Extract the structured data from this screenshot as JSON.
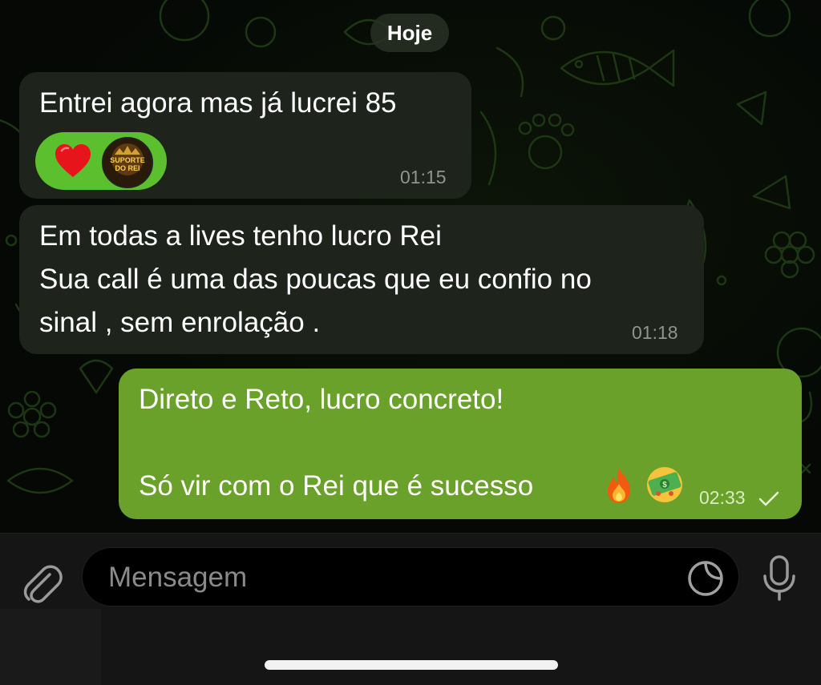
{
  "date_chip": "Hoje",
  "messages": [
    {
      "text": "Entrei agora mas já lucrei 85",
      "time": "01:15",
      "reactions": [
        "heart",
        "avatar"
      ]
    },
    {
      "text": "Em todas a lives tenho lucro Rei\nSua call é uma das poucas que eu confio no\nsinal , sem enrolação .",
      "time": "01:18"
    },
    {
      "text": "Direto e Reto, lucro concreto!\n\nSó vir com o Rei que é sucesso",
      "time": "02:33",
      "status": "sent-check"
    }
  ],
  "reaction_avatar_text": "SUPORTE DO REI",
  "composer": {
    "placeholder": "Mensagem"
  },
  "icons": {
    "attach": "paperclip-icon",
    "sticker": "sticker-icon",
    "mic": "microphone-icon",
    "fire": "fire-emoji",
    "money": "money-emoji"
  },
  "colors": {
    "incoming_bubble": "#1e241c",
    "outgoing_bubble": "#6aa12a",
    "reaction_pill": "#5bbf2e",
    "heart": "#e8141c"
  }
}
